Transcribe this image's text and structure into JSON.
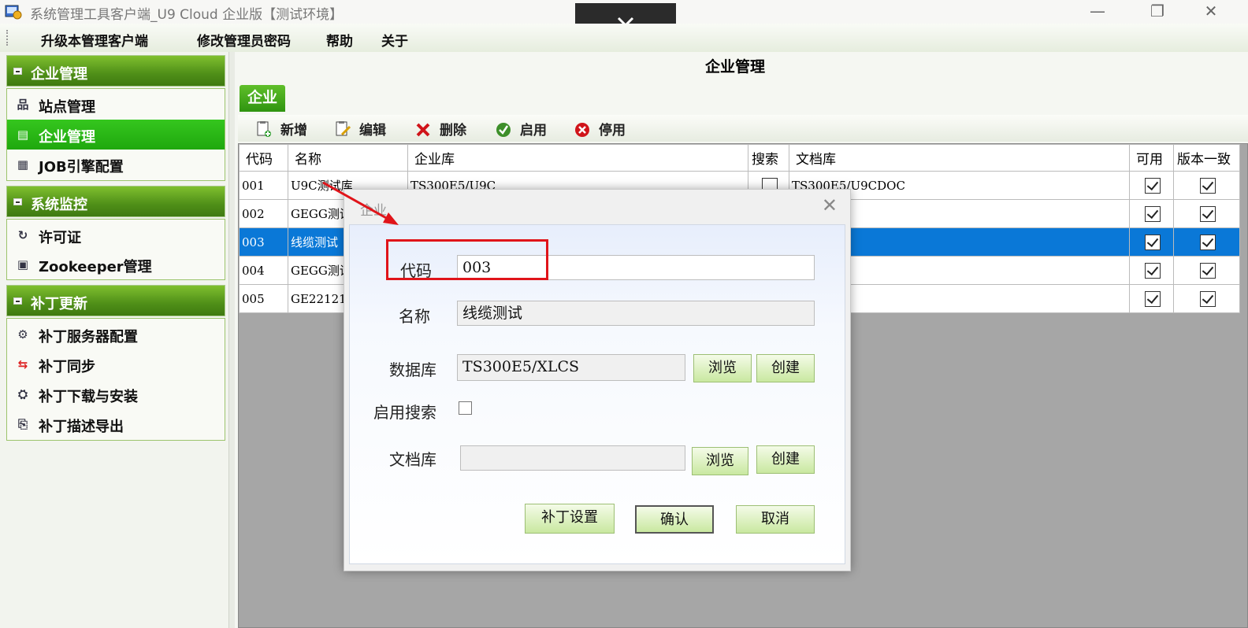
{
  "window": {
    "title": "系统管理工具客户端_U9 Cloud 企业版【测试环境】",
    "minimize": "—",
    "restore": "❐",
    "close": "✕",
    "overlay_icon": "chevron-down-icon"
  },
  "menu": [
    "升级本管理客户端",
    "修改管理员密码",
    "帮助",
    "关于"
  ],
  "sidebar": {
    "groups": [
      {
        "title": "企业管理",
        "items": [
          {
            "label": "站点管理",
            "icon": "sitemap-icon",
            "active": false
          },
          {
            "label": "企业管理",
            "icon": "server-icon",
            "active": true
          },
          {
            "label": "JOB引擎配置",
            "icon": "job-config-icon",
            "active": false
          }
        ]
      },
      {
        "title": "系统监控",
        "items": [
          {
            "label": "许可证",
            "icon": "license-icon",
            "active": false
          },
          {
            "label": "Zookeeper管理",
            "icon": "zookeeper-icon",
            "active": false
          }
        ]
      },
      {
        "title": "补丁更新",
        "items": [
          {
            "label": "补丁服务器配置",
            "icon": "patch-server-icon",
            "active": false
          },
          {
            "label": "补丁同步",
            "icon": "sync-icon",
            "active": false
          },
          {
            "label": "补丁下载与安装",
            "icon": "download-icon",
            "active": false
          },
          {
            "label": "补丁描述导出",
            "icon": "export-icon",
            "active": false
          }
        ]
      }
    ]
  },
  "main": {
    "title": "企业管理",
    "tab": "企业",
    "toolbar": {
      "new": "新增",
      "edit": "编辑",
      "delete": "删除",
      "enable": "启用",
      "disable": "停用"
    },
    "grid": {
      "columns": [
        "代码",
        "名称",
        "企业库",
        "搜索",
        "文档库",
        "可用",
        "版本一致"
      ],
      "rows": [
        {
          "code": "001",
          "name": "U9C测试库",
          "db": "TS300E5/U9C",
          "search": false,
          "docdb": "TS300E5/U9CDOC",
          "available": true,
          "consistent": true
        },
        {
          "code": "002",
          "name": "GEGG测试",
          "db": "",
          "search": false,
          "docdb": "",
          "available": true,
          "consistent": true
        },
        {
          "code": "003",
          "name": "线缆测试",
          "db": "",
          "search": false,
          "docdb": "",
          "available": true,
          "consistent": true
        },
        {
          "code": "004",
          "name": "GEGG测试",
          "db": "",
          "search": false,
          "docdb": "",
          "available": true,
          "consistent": true
        },
        {
          "code": "005",
          "name": "GE221213",
          "db": "",
          "search": false,
          "docdb": "",
          "available": true,
          "consistent": true
        }
      ],
      "selected_row": 2
    }
  },
  "dialog": {
    "title": "企业",
    "close": "✕",
    "code_label": "代码",
    "code_value": "003",
    "name_label": "名称",
    "name_value": "线缆测试",
    "db_label": "数据库",
    "db_value": "TS300E5/XLCS",
    "browse": "浏览",
    "create": "创建",
    "search_label": "启用搜索",
    "search_checked": false,
    "docdb_label": "文档库",
    "docdb_value": "",
    "patch_settings": "补丁设置",
    "confirm": "确认",
    "cancel": "取消"
  },
  "colors": {
    "accent_green": "#2f9410",
    "selected_blue": "#0a78d7",
    "annotation_red": "#e0141a"
  }
}
